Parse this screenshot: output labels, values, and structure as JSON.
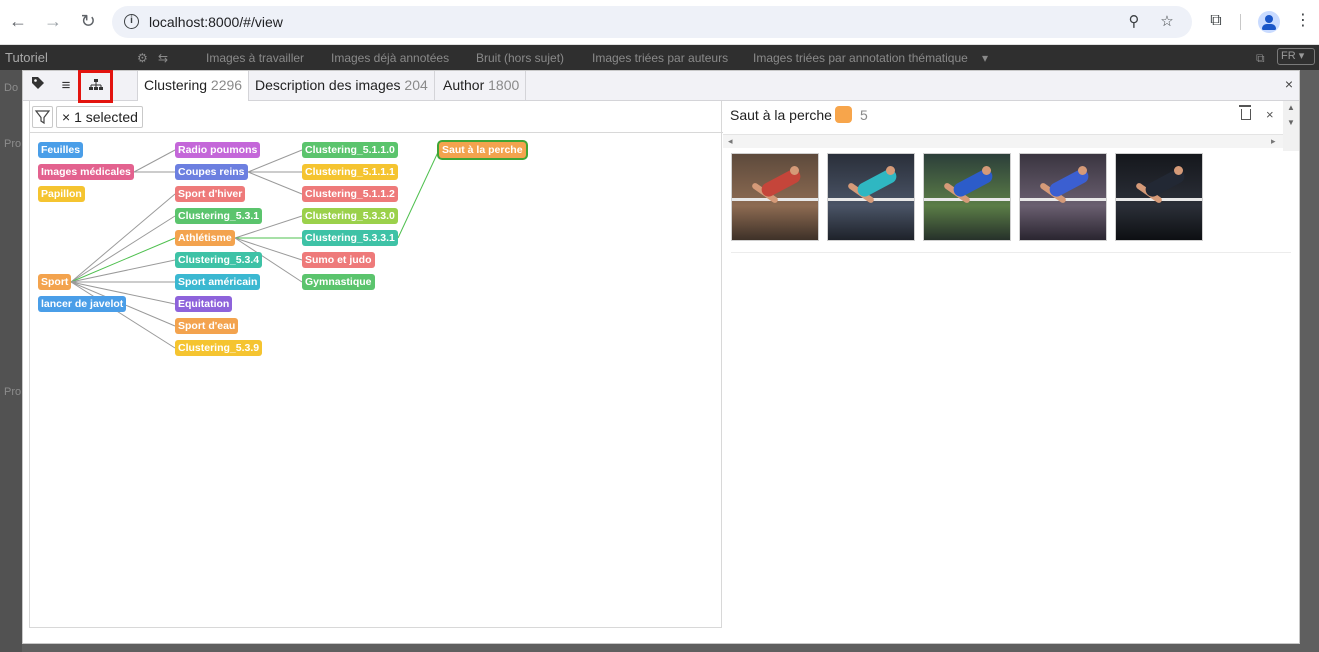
{
  "browser": {
    "url": "localhost:8000/#/view"
  },
  "background_app": {
    "brand": "Tutoriel",
    "tabs": [
      "Images à travailler",
      "Images déjà annotées",
      "Bruit (hors sujet)",
      "Images triées par auteurs",
      "Images triées par annotation thématique"
    ],
    "language": "FR"
  },
  "modal": {
    "close_label": "×",
    "tabs": [
      {
        "label": "Clustering",
        "count": "2296"
      },
      {
        "label": "Description des images",
        "count": "204"
      },
      {
        "label": "Author",
        "count": "1800"
      }
    ],
    "filter": {
      "chip_label": "× 1 selected"
    },
    "tree": {
      "nodes": [
        {
          "id": "feuilles",
          "label": "Feuilles",
          "color": "#4a9ee8"
        },
        {
          "id": "images_medicales",
          "label": "Images médicales",
          "color": "#e3628f"
        },
        {
          "id": "papillon",
          "label": "Papillon",
          "color": "#f5c430"
        },
        {
          "id": "sport",
          "label": "Sport",
          "color": "#f3a34e"
        },
        {
          "id": "lancer",
          "label": "lancer de javelot",
          "color": "#4a9ee8"
        },
        {
          "id": "radio",
          "label": "Radio poumons",
          "color": "#c467d9"
        },
        {
          "id": "coupes",
          "label": "Coupes reins",
          "color": "#6c7fe0"
        },
        {
          "id": "hiver",
          "label": "Sport d'hiver",
          "color": "#ee7a7a"
        },
        {
          "id": "c531",
          "label": "Clustering_5.3.1",
          "color": "#5bc46d"
        },
        {
          "id": "athletisme",
          "label": "Athlétisme",
          "color": "#f3a34e"
        },
        {
          "id": "c534",
          "label": "Clustering_5.3.4",
          "color": "#3ec2a6"
        },
        {
          "id": "americain",
          "label": "Sport américain",
          "color": "#3bb8d1"
        },
        {
          "id": "equitation",
          "label": "Equitation",
          "color": "#8e63db"
        },
        {
          "id": "eau",
          "label": "Sport d'eau",
          "color": "#f3a34e"
        },
        {
          "id": "c539",
          "label": "Clustering_5.3.9",
          "color": "#f5c430"
        },
        {
          "id": "c5110",
          "label": "Clustering_5.1.1.0",
          "color": "#5bc46d"
        },
        {
          "id": "c5111",
          "label": "Clustering_5.1.1.1",
          "color": "#f5c430"
        },
        {
          "id": "c5112",
          "label": "Clustering_5.1.1.2",
          "color": "#ee7a7a"
        },
        {
          "id": "c5330",
          "label": "Clustering_5.3.3.0",
          "color": "#9bd14b"
        },
        {
          "id": "c5331",
          "label": "Clustering_5.3.3.1",
          "color": "#3ec2a6"
        },
        {
          "id": "sumo",
          "label": "Sumo et judo",
          "color": "#ee7a7a"
        },
        {
          "id": "gym",
          "label": "Gymnastique",
          "color": "#5bc46d"
        },
        {
          "id": "perche",
          "label": "Saut à la perche",
          "color": "#f3a34e",
          "selected": true
        }
      ]
    },
    "detail": {
      "title": "Saut à la perche",
      "swatch_color": "#f7a54b",
      "count": "5",
      "close_label": "×",
      "images": [
        {
          "alt": "athlete-high-jump-1"
        },
        {
          "alt": "athlete-high-jump-2"
        },
        {
          "alt": "athlete-high-jump-3"
        },
        {
          "alt": "athlete-high-jump-4"
        },
        {
          "alt": "athlete-high-jump-5"
        }
      ]
    }
  }
}
